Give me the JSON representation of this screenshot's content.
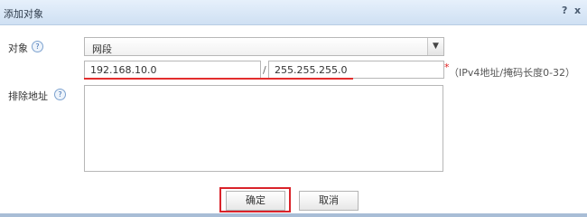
{
  "dialog": {
    "title": "添加对象",
    "help_label": "?",
    "close_label": "x"
  },
  "form": {
    "object_label": "对象",
    "object_help": "?",
    "object_value": "网段",
    "ip_value": "192.168.10.0",
    "separator": "/",
    "mask_value": "255.255.255.0",
    "required_mark": "*",
    "hint": "（IPv4地址/掩码长度0-32）",
    "exclude_label": "排除地址",
    "exclude_help": "?",
    "exclude_value": ""
  },
  "buttons": {
    "ok": "确定",
    "cancel": "取消"
  },
  "colors": {
    "title_bar": "#cfe0f3",
    "highlight": "#e32d2d"
  }
}
